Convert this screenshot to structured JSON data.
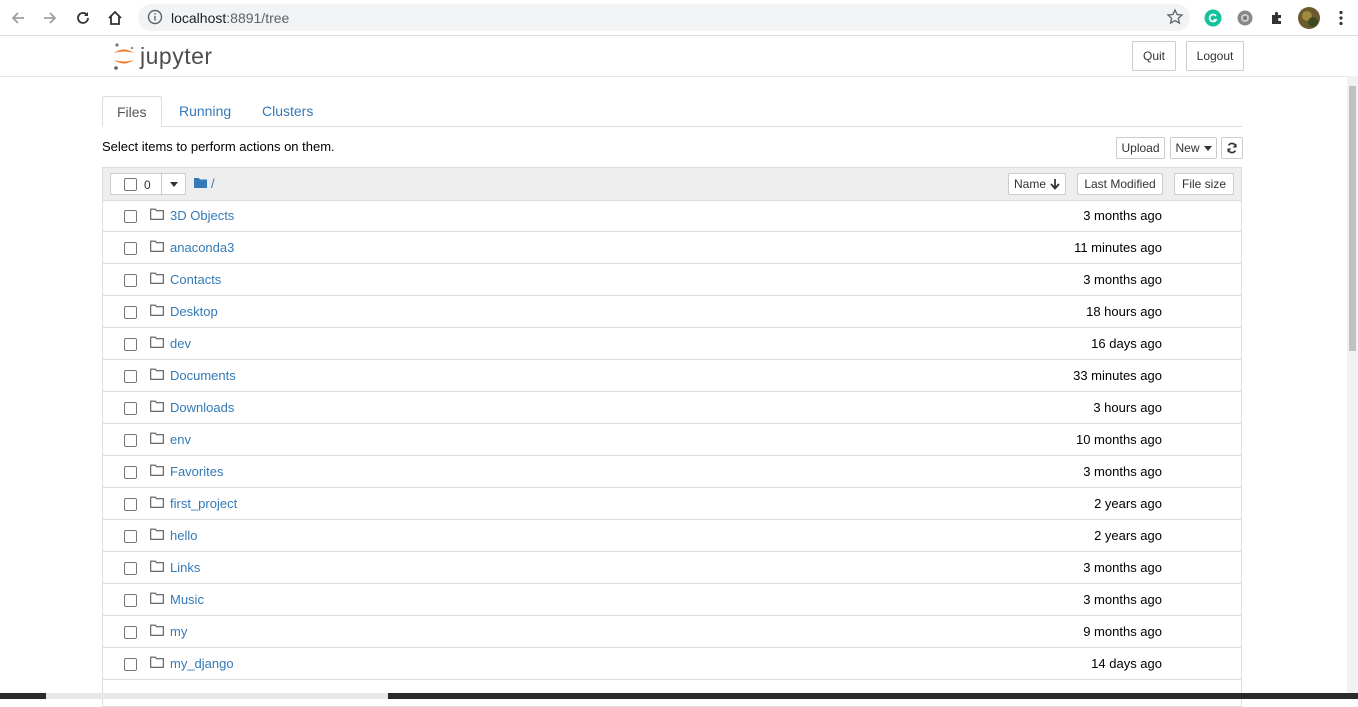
{
  "browser": {
    "url_host": "localhost",
    "url_rest": ":8891/tree"
  },
  "header": {
    "logo_text": "jupyter",
    "quit_label": "Quit",
    "logout_label": "Logout"
  },
  "tabs": [
    {
      "label": "Files",
      "active": true
    },
    {
      "label": "Running",
      "active": false
    },
    {
      "label": "Clusters",
      "active": false
    }
  ],
  "toolbar": {
    "hint": "Select items to perform actions on them.",
    "upload_label": "Upload",
    "new_label": "New"
  },
  "list_header": {
    "selected_count": "0",
    "path": "/",
    "sort_name_label": "Name",
    "sort_modified_label": "Last Modified",
    "sort_size_label": "File size"
  },
  "rows": [
    {
      "name": "3D Objects",
      "modified": "3 months ago"
    },
    {
      "name": "anaconda3",
      "modified": "11 minutes ago"
    },
    {
      "name": "Contacts",
      "modified": "3 months ago"
    },
    {
      "name": "Desktop",
      "modified": "18 hours ago"
    },
    {
      "name": "dev",
      "modified": "16 days ago"
    },
    {
      "name": "Documents",
      "modified": "33 minutes ago"
    },
    {
      "name": "Downloads",
      "modified": "3 hours ago"
    },
    {
      "name": "env",
      "modified": "10 months ago"
    },
    {
      "name": "Favorites",
      "modified": "3 months ago"
    },
    {
      "name": "first_project",
      "modified": "2 years ago"
    },
    {
      "name": "hello",
      "modified": "2 years ago"
    },
    {
      "name": "Links",
      "modified": "3 months ago"
    },
    {
      "name": "Music",
      "modified": "3 months ago"
    },
    {
      "name": "my",
      "modified": "9 months ago"
    },
    {
      "name": "my_django",
      "modified": "14 days ago"
    }
  ],
  "colors": {
    "link": "#337ab7",
    "logo_orange": "#f37726"
  }
}
